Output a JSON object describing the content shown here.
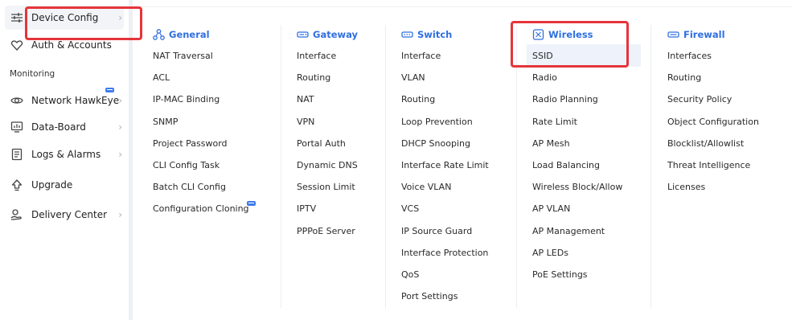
{
  "sidebar": {
    "items": [
      {
        "label": "Device Config",
        "icon": "sliders-icon",
        "chevron": "›"
      },
      {
        "label": "Auth & Accounts",
        "icon": "shield-heart-icon",
        "chevron": ""
      },
      {
        "label": "Network HawkEye",
        "icon": "eye-icon",
        "chevron": "›"
      },
      {
        "label": "Data-Board",
        "icon": "monitor-chart-icon",
        "chevron": "›"
      },
      {
        "label": "Logs & Alarms",
        "icon": "document-list-icon",
        "chevron": "›"
      },
      {
        "label": "Upgrade",
        "icon": "upload-arrow-icon",
        "chevron": ""
      },
      {
        "label": "Delivery Center",
        "icon": "delivery-hand-icon",
        "chevron": "›"
      }
    ],
    "section_monitoring": "Monitoring"
  },
  "menu": {
    "columns": [
      {
        "title": "General",
        "icon": "network-nodes-icon",
        "items": [
          "NAT Traversal",
          "ACL",
          "IP-MAC Binding",
          "SNMP",
          "Project Password",
          "CLI Config Task",
          "Batch CLI Config",
          "Configuration Cloning"
        ]
      },
      {
        "title": "Gateway",
        "icon": "router-icon",
        "items": [
          "Interface",
          "Routing",
          "NAT",
          "VPN",
          "Portal Auth",
          "Dynamic DNS",
          "Session Limit",
          "IPTV",
          "PPPoE Server"
        ]
      },
      {
        "title": "Switch",
        "icon": "switch-icon",
        "items": [
          "Interface",
          "VLAN",
          "Routing",
          "Loop Prevention",
          "DHCP Snooping",
          "Interface Rate Limit",
          "Voice VLAN",
          "VCS",
          "IP Source Guard",
          "Interface Protection",
          "QoS",
          "Port Settings"
        ]
      },
      {
        "title": "Wireless",
        "icon": "access-point-icon",
        "items": [
          "SSID",
          "Radio",
          "Radio Planning",
          "Rate Limit",
          "AP Mesh",
          "Load Balancing",
          "Wireless Block/Allow",
          "AP VLAN",
          "AP Management",
          "AP LEDs",
          "PoE Settings"
        ]
      },
      {
        "title": "Firewall",
        "icon": "firewall-icon",
        "items": [
          "Interfaces",
          "Routing",
          "Security Policy",
          "Object Configuration",
          "Blocklist/Allowlist",
          "Threat Intelligence",
          "Licenses"
        ]
      }
    ]
  },
  "colors": {
    "accent": "#2f6fe0",
    "highlight": "#e5353a",
    "beta": "#3d7cf0",
    "selected_bg": "#eef2fb"
  }
}
